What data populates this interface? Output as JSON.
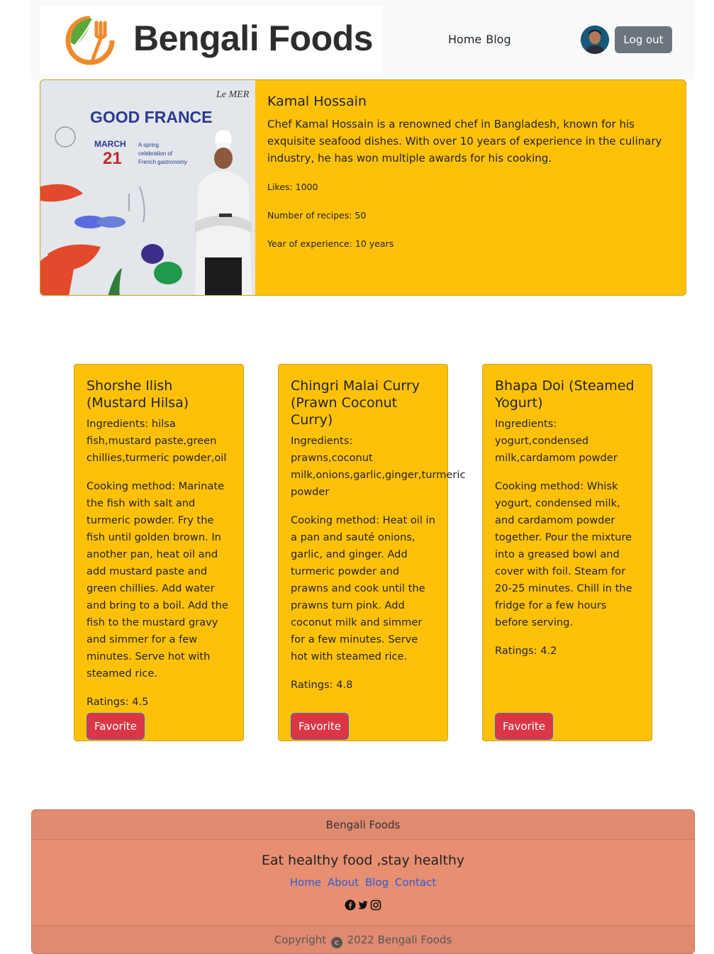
{
  "header": {
    "brand": "Bengali Foods",
    "nav": [
      "Home",
      "Blog"
    ],
    "logout_label": "Log out"
  },
  "chef": {
    "name": "Kamal Hossain",
    "bio": "Chef Kamal Hossain is a renowned chef in Bangladesh, known for his exquisite seafood dishes. With over 10 years of experience in the culinary industry, he has won multiple awards for his cooking.",
    "likes": "Likes: 1000",
    "recipes": "Number of recipes: 50",
    "experience": "Year of experience: 10 years",
    "photo_text": {
      "headline": "GOOD FRANCE",
      "month": "MARCH",
      "day": "21",
      "tagline_1": "A spring",
      "tagline_2": "celebration of",
      "tagline_3": "French gastronomy",
      "corner": "Le MER"
    }
  },
  "recipes": [
    {
      "title": "Shorshe Ilish (Mustard Hilsa)",
      "ingredients": "Ingredients: hilsa fish,mustard paste,green chillies,turmeric powder,oil",
      "method": "Cooking method: Marinate the fish with salt and turmeric powder. Fry the fish until golden brown. In another pan, heat oil and add mustard paste and green chillies. Add water and bring to a boil. Add the fish to the mustard gravy and simmer for a few minutes. Serve hot with steamed rice.",
      "rating": "Ratings: 4.5",
      "button": "Favorite"
    },
    {
      "title": "Chingri Malai Curry (Prawn Coconut Curry)",
      "ingredients": "Ingredients: prawns,coconut milk,onions,garlic,ginger,turmeric powder",
      "method": "Cooking method: Heat oil in a pan and sauté onions, garlic, and ginger. Add turmeric powder and prawns and cook until the prawns turn pink. Add coconut milk and simmer for a few minutes. Serve hot with steamed rice.",
      "rating": "Ratings: 4.8",
      "button": "Favorite"
    },
    {
      "title": "Bhapa Doi (Steamed Yogurt)",
      "ingredients": "Ingredients: yogurt,condensed milk,cardamom powder",
      "method": "Cooking method: Whisk yogurt, condensed milk, and cardamom powder together. Pour the mixture into a greased bowl and cover with foil. Steam for 20-25 minutes. Chill in the fridge for a few hours before serving.",
      "rating": "Ratings: 4.2",
      "button": "Favorite"
    }
  ],
  "footer": {
    "header": "Bengali Foods",
    "tagline": "Eat healthy food ,stay healthy",
    "links": [
      "Home",
      "About",
      "Blog",
      "Contact"
    ],
    "social_icons": [
      "facebook-icon",
      "twitter-icon",
      "instagram-icon"
    ],
    "copyright_prefix": "Copyright",
    "copyright_suffix": "2022 Bengali Foods"
  },
  "colors": {
    "card": "#ffc107",
    "favorite": "#dc3545",
    "footer": "#e88f72",
    "logout": "#6c757d"
  }
}
